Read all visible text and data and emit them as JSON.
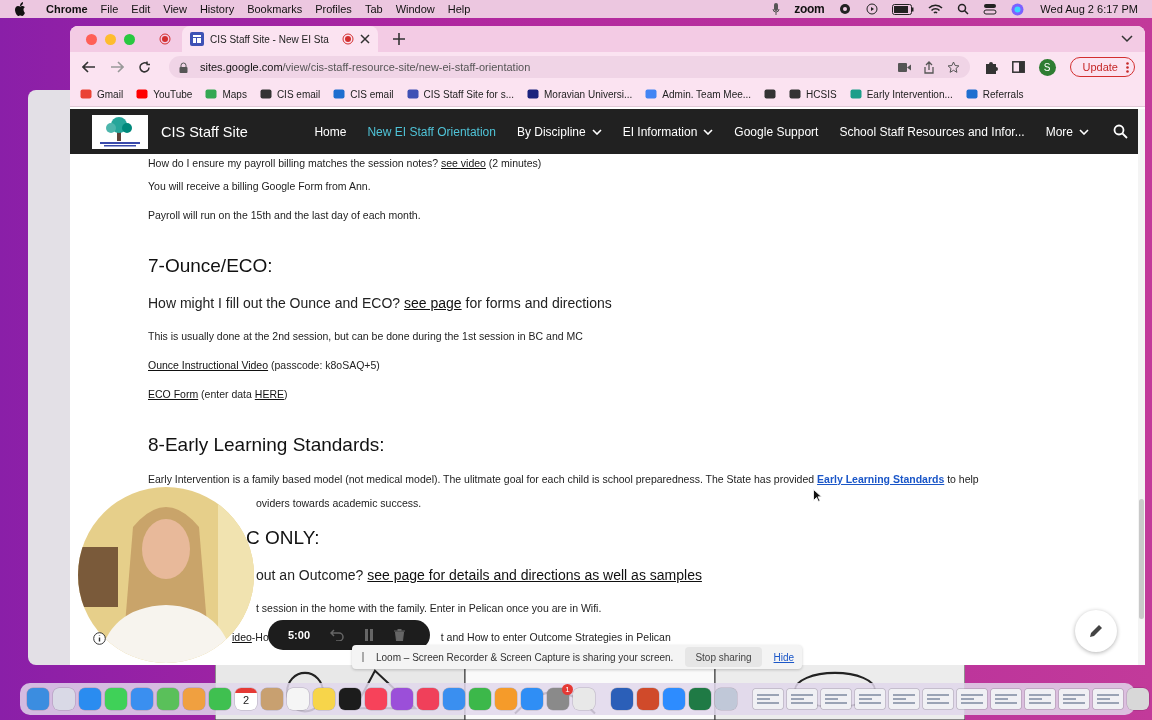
{
  "menubar": {
    "app": "Chrome",
    "menus": [
      "File",
      "Edit",
      "View",
      "History",
      "Bookmarks",
      "Profiles",
      "Tab",
      "Window",
      "Help"
    ],
    "zoom": "zoom",
    "clock": "Wed Aug 2  6:17 PM"
  },
  "browser": {
    "tab": {
      "title": "CIS Staff Site - New EI Sta",
      "recording": true
    },
    "url": {
      "domain": "sites.google.com",
      "path": "/view/cis-staff-resource-site/new-ei-staff-orientation"
    },
    "profile": "S",
    "update": "Update",
    "bookmarks": [
      {
        "label": "Gmail",
        "color": "#ea4335"
      },
      {
        "label": "YouTube",
        "color": "#ff0000"
      },
      {
        "label": "Maps",
        "color": "#34a853"
      },
      {
        "label": "CIS email",
        "color": "#333333"
      },
      {
        "label": "CIS email",
        "color": "#1e6fd0"
      },
      {
        "label": "CIS Staff Site for s...",
        "color": "#3f51b5"
      },
      {
        "label": "Moravian Universi...",
        "color": "#1a237e"
      },
      {
        "label": "Admin. Team Mee...",
        "color": "#4285f4"
      },
      {
        "color": "#333333"
      },
      {
        "label": "HCSIS",
        "color": "#333333"
      },
      {
        "label": "Early Intervention...",
        "color": "#1b9e8a"
      },
      {
        "label": "Referrals",
        "color": "#1e6fd0"
      }
    ]
  },
  "site": {
    "title": "CIS Staff Site",
    "nav": [
      {
        "label": "Home",
        "selected": false,
        "dropdown": false
      },
      {
        "label": "New EI Staff Orientation",
        "selected": true,
        "dropdown": false
      },
      {
        "label": "By Discipline",
        "selected": false,
        "dropdown": true
      },
      {
        "label": "EI Information",
        "selected": false,
        "dropdown": true
      },
      {
        "label": "Google Support",
        "selected": false,
        "dropdown": false
      },
      {
        "label": "School Staff Resources and Infor...",
        "selected": false,
        "dropdown": false
      },
      {
        "label": "More",
        "selected": false,
        "dropdown": true
      }
    ]
  },
  "content": [
    {
      "kind": "p",
      "segments": [
        {
          "text": "How do I ensure my payroll billing matches the session notes?  "
        },
        {
          "text": "see video",
          "link": true
        },
        {
          "text": " (2 minutes)"
        }
      ]
    },
    {
      "kind": "p",
      "segments": [
        {
          "text": "You will receive a billing Google Form from Ann."
        }
      ]
    },
    {
      "kind": "p",
      "segments": [
        {
          "text": "Payroll will run on the 15th and the last day of each month."
        }
      ]
    },
    {
      "kind": "heading",
      "segments": [
        {
          "text": "7-Ounce/ECO:"
        }
      ]
    },
    {
      "kind": "sub",
      "segments": [
        {
          "text": "How might I fill out the Ounce and ECO? "
        },
        {
          "text": "see page",
          "link": true
        },
        {
          "text": " for forms and directions"
        }
      ]
    },
    {
      "kind": "p",
      "segments": [
        {
          "text": "This is usually done at the 2nd session, but can be done during the 1st session in BC and MC"
        }
      ]
    },
    {
      "kind": "p",
      "segments": [
        {
          "text": "Ounce Instructional Video",
          "link": true
        },
        {
          "text": " (passcode: k8oSAQ+5)"
        }
      ]
    },
    {
      "kind": "p",
      "segments": [
        {
          "text": "ECO Form",
          "link": true
        },
        {
          "text": " (enter data "
        },
        {
          "text": "HERE",
          "link": true
        },
        {
          "text": ")"
        }
      ]
    },
    {
      "kind": "heading",
      "segments": [
        {
          "text": "8-Early Learning Standards:"
        }
      ]
    },
    {
      "kind": "p",
      "segments": [
        {
          "text": "Early Intervention is a family based model (not medical model).  The ulitmate goal for each child is school preparedness.  The State has provided "
        },
        {
          "text": "Early Learning Standards",
          "link": true,
          "strong": true
        },
        {
          "text": " to help"
        }
      ]
    },
    {
      "kind": "cont",
      "segments": [
        {
          "text": "oviders towards academic success."
        }
      ]
    },
    {
      "kind": "heading",
      "segments": [
        {
          "text": "C ONLY:"
        }
      ]
    },
    {
      "kind": "sub",
      "segments": [
        {
          "text": "out an Outcome? "
        },
        {
          "text": "see page for details and directions as well as samples",
          "link": true
        }
      ]
    },
    {
      "kind": "p",
      "segments": [
        {
          "text": "t session in the home with the family. Enter in Pelican once you are in Wifi."
        }
      ]
    },
    {
      "kind": "p",
      "segments": [
        {
          "text": "ideo",
          "link": true
        },
        {
          "text": "-Ho"
        },
        {
          "text": "t and How to enter Outcome Strategies in Pelican"
        }
      ]
    }
  ],
  "recorder": {
    "time": "5:00",
    "paused": false,
    "notice": "Loom – Screen Recorder & Screen Capture is sharing your screen.",
    "stop": "Stop sharing",
    "hide": "Hide"
  },
  "dock": [
    {
      "kind": "app",
      "color": "#3b8de0"
    },
    {
      "kind": "app",
      "color": "#d9d9e6"
    },
    {
      "kind": "app",
      "color": "#2a8cf0"
    },
    {
      "kind": "app",
      "color": "#3fd158"
    },
    {
      "kind": "app",
      "color": "#3a8ff0"
    },
    {
      "kind": "app",
      "color": "#5ac05a"
    },
    {
      "kind": "app",
      "color": "#f0a040"
    },
    {
      "kind": "app",
      "color": "#3fc050"
    },
    {
      "kind": "calendar",
      "color": "#ffffff",
      "day": "2"
    },
    {
      "kind": "app",
      "color": "#c8a070"
    },
    {
      "kind": "app",
      "color": "#f5f5f5"
    },
    {
      "kind": "app",
      "color": "#f7d54a"
    },
    {
      "kind": "app",
      "color": "#1c1c1c"
    },
    {
      "kind": "app",
      "color": "#f7425a"
    },
    {
      "kind": "app",
      "color": "#9b4fd9"
    },
    {
      "kind": "app",
      "color": "#f0405a"
    },
    {
      "kind": "app",
      "color": "#3a8ff0"
    },
    {
      "kind": "app",
      "color": "#3cb84a"
    },
    {
      "kind": "app",
      "color": "#f59b2a"
    },
    {
      "kind": "app",
      "color": "#2f8ef5"
    },
    {
      "kind": "app",
      "color": "#8a8a8a",
      "badge": "1"
    },
    {
      "kind": "app",
      "color": "#e8e8e8"
    },
    {
      "kind": "separator"
    },
    {
      "kind": "app",
      "color": "#2b5fb8"
    },
    {
      "kind": "app",
      "color": "#d04a2a"
    },
    {
      "kind": "app",
      "color": "#2d8cff"
    },
    {
      "kind": "app",
      "color": "#1f7a45"
    },
    {
      "kind": "app",
      "color": "#c0c8d8"
    },
    {
      "kind": "separator"
    },
    {
      "kind": "window",
      "color": "#f0f0f4"
    },
    {
      "kind": "window",
      "color": "#f0f0f4"
    },
    {
      "kind": "window",
      "color": "#f0f0f4"
    },
    {
      "kind": "window",
      "color": "#f0f0f4"
    },
    {
      "kind": "window",
      "color": "#f0f0f4"
    },
    {
      "kind": "window",
      "color": "#f0f0f4"
    },
    {
      "kind": "window",
      "color": "#f0f0f4"
    },
    {
      "kind": "window",
      "color": "#f0f0f4"
    },
    {
      "kind": "window",
      "color": "#f0f0f4"
    },
    {
      "kind": "window",
      "color": "#f0f0f4"
    },
    {
      "kind": "window",
      "color": "#f0f0f4"
    },
    {
      "kind": "app",
      "color": "#d8d8d8"
    }
  ]
}
